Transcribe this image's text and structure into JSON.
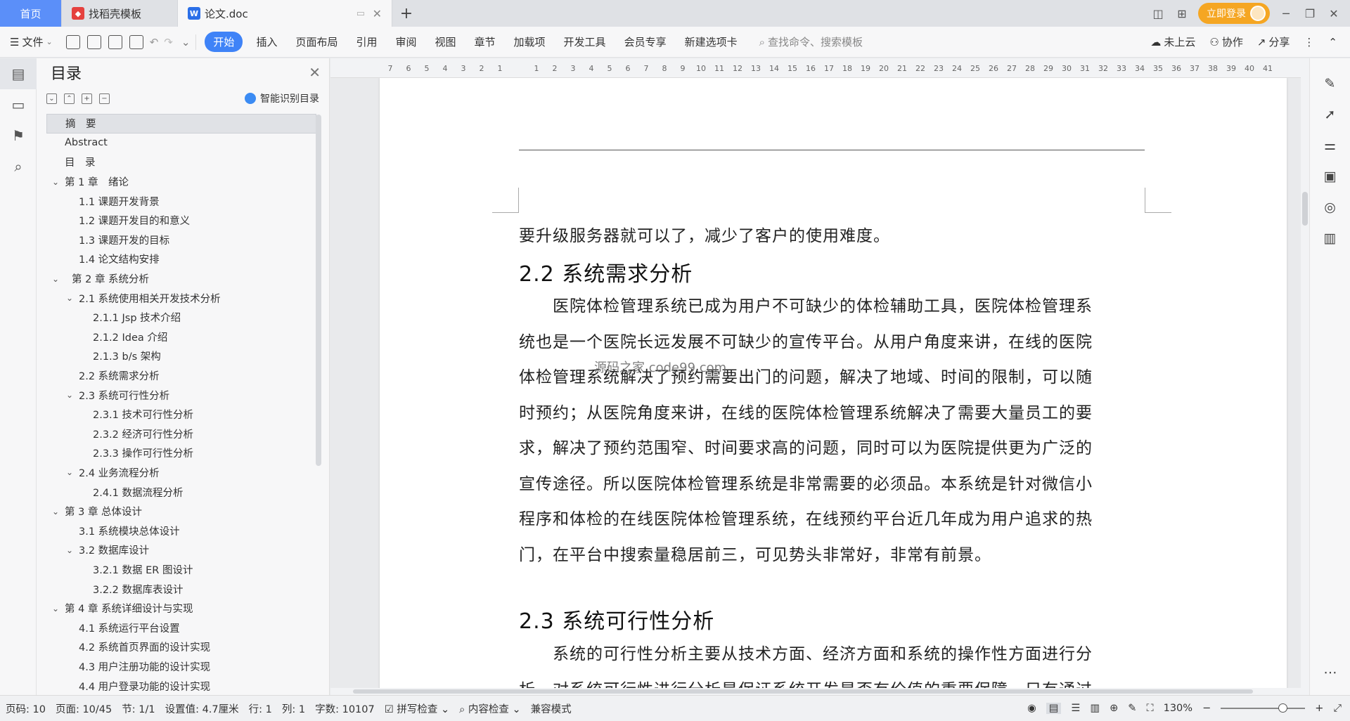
{
  "tabs": {
    "home": "首页",
    "templates": "找稻壳模板",
    "document": "论文.doc"
  },
  "title_bar": {
    "login_label": "立即登录"
  },
  "ribbon": {
    "file_label": "文件",
    "menu": [
      "开始",
      "插入",
      "页面布局",
      "引用",
      "审阅",
      "视图",
      "章节",
      "加载项",
      "开发工具",
      "会员专享",
      "新建选项卡"
    ],
    "active_menu": "开始",
    "search_placeholder": "查找命令、搜索模板",
    "cloud_label": "未上云",
    "collab_label": "协作",
    "share_label": "分享"
  },
  "toc": {
    "title": "目录",
    "smart_label": "智能识别目录",
    "items": [
      {
        "text": "摘　要",
        "level": 0,
        "chev": "",
        "selected": true
      },
      {
        "text": "Abstract",
        "level": 0,
        "chev": ""
      },
      {
        "text": "目　录",
        "level": 0,
        "chev": ""
      },
      {
        "text": "第 1 章　绪论",
        "level": 0,
        "chev": "v"
      },
      {
        "text": "1.1 课题开发背景",
        "level": 1,
        "chev": ""
      },
      {
        "text": "1.2 课题开发目的和意义",
        "level": 1,
        "chev": ""
      },
      {
        "text": "1.3 课题开发的目标",
        "level": 1,
        "chev": ""
      },
      {
        "text": "1.4 论文结构安排",
        "level": 1,
        "chev": ""
      },
      {
        "text": "第 2 章 系统分析",
        "level": 0,
        "chev": "v",
        "indent_extra": true
      },
      {
        "text": "2.1 系统使用相关开发技术分析",
        "level": 1,
        "chev": "v"
      },
      {
        "text": "2.1.1 Jsp 技术介绍",
        "level": 2,
        "chev": ""
      },
      {
        "text": "2.1.2 Idea 介绍",
        "level": 2,
        "chev": ""
      },
      {
        "text": "2.1.3 b/s 架构",
        "level": 2,
        "chev": ""
      },
      {
        "text": "2.2 系统需求分析",
        "level": 1,
        "chev": ""
      },
      {
        "text": "2.3 系统可行性分析",
        "level": 1,
        "chev": "v"
      },
      {
        "text": "2.3.1 技术可行性分析",
        "level": 2,
        "chev": ""
      },
      {
        "text": "2.3.2 经济可行性分析",
        "level": 2,
        "chev": ""
      },
      {
        "text": "2.3.3 操作可行性分析",
        "level": 2,
        "chev": ""
      },
      {
        "text": "2.4 业务流程分析",
        "level": 1,
        "chev": "v"
      },
      {
        "text": "2.4.1 数据流程分析",
        "level": 2,
        "chev": ""
      },
      {
        "text": "第 3 章 总体设计",
        "level": 0,
        "chev": "v"
      },
      {
        "text": "3.1 系统模块总体设计",
        "level": 1,
        "chev": ""
      },
      {
        "text": "3.2 数据库设计",
        "level": 1,
        "chev": "v"
      },
      {
        "text": "3.2.1 数据 ER 图设计",
        "level": 2,
        "chev": ""
      },
      {
        "text": "3.2.2 数据库表设计",
        "level": 2,
        "chev": ""
      },
      {
        "text": "第 4 章 系统详细设计与实现",
        "level": 0,
        "chev": "v"
      },
      {
        "text": "4.1 系统运行平台设置",
        "level": 1,
        "chev": ""
      },
      {
        "text": "4.2 系统首页界面的设计实现",
        "level": 1,
        "chev": ""
      },
      {
        "text": "4.3 用户注册功能的设计实现",
        "level": 1,
        "chev": ""
      },
      {
        "text": "4.4 用户登录功能的设计实现",
        "level": 1,
        "chev": ""
      }
    ]
  },
  "ruler": {
    "ticks": [
      "7",
      "6",
      "5",
      "4",
      "3",
      "2",
      "1",
      "",
      "1",
      "2",
      "3",
      "4",
      "5",
      "6",
      "7",
      "8",
      "9",
      "10",
      "11",
      "12",
      "13",
      "14",
      "15",
      "16",
      "17",
      "18",
      "19",
      "20",
      "21",
      "22",
      "23",
      "24",
      "25",
      "26",
      "27",
      "28",
      "29",
      "30",
      "31",
      "32",
      "33",
      "34",
      "35",
      "36",
      "37",
      "38",
      "39",
      "40",
      "41"
    ]
  },
  "document": {
    "line_top": "要升级服务器就可以了，减少了客户的使用难度。",
    "heading_22": "2.2 系统需求分析",
    "para_22": [
      "　　医院体检管理系统已成为用户不可缺少的体检辅助工具，医院体检管理系",
      "统也是一个医院长远发展不可缺少的宣传平台。从用户角度来讲，在线的医院",
      "体检管理系统解决了预约需要出门的问题，解决了地域、时间的限制，可以随",
      "时预约；从医院角度来讲，在线的医院体检管理系统解决了需要大量员工的要",
      "求，解决了预约范围窄、时间要求高的问题，同时可以为医院提供更为广泛的",
      "宣传途径。所以医院体检管理系统是非常需要的必须品。本系统是针对微信小",
      "程序和体检的在线医院体检管理系统，在线预约平台近几年成为用户追求的热",
      "门，在平台中搜索量稳居前三，可见势头非常好，非常有前景。"
    ],
    "heading_23": "2.3 系统可行性分析",
    "para_23": [
      "　　系统的可行性分析主要从技术方面、经济方面和系统的操作性方面进行分",
      "析，对系统可行性进行分析是保证系统开发是否有价值的重要保障，只有通过"
    ],
    "watermark": "源码之家 code99.com"
  },
  "status": {
    "page_code": "页码: 10",
    "page": "页面: 10/45",
    "section": "节: 1/1",
    "setting": "设置值: 4.7厘米",
    "row": "行: 1",
    "col": "列: 1",
    "words": "字数: 10107",
    "spell": "拼写检查",
    "content_check": "内容检查",
    "compat": "兼容模式",
    "zoom": "130%",
    "zoom_level_percent": 130
  },
  "colors": {
    "accent": "#3f83f7",
    "home_tab": "#5b8ff9",
    "login": "#f5a623"
  }
}
